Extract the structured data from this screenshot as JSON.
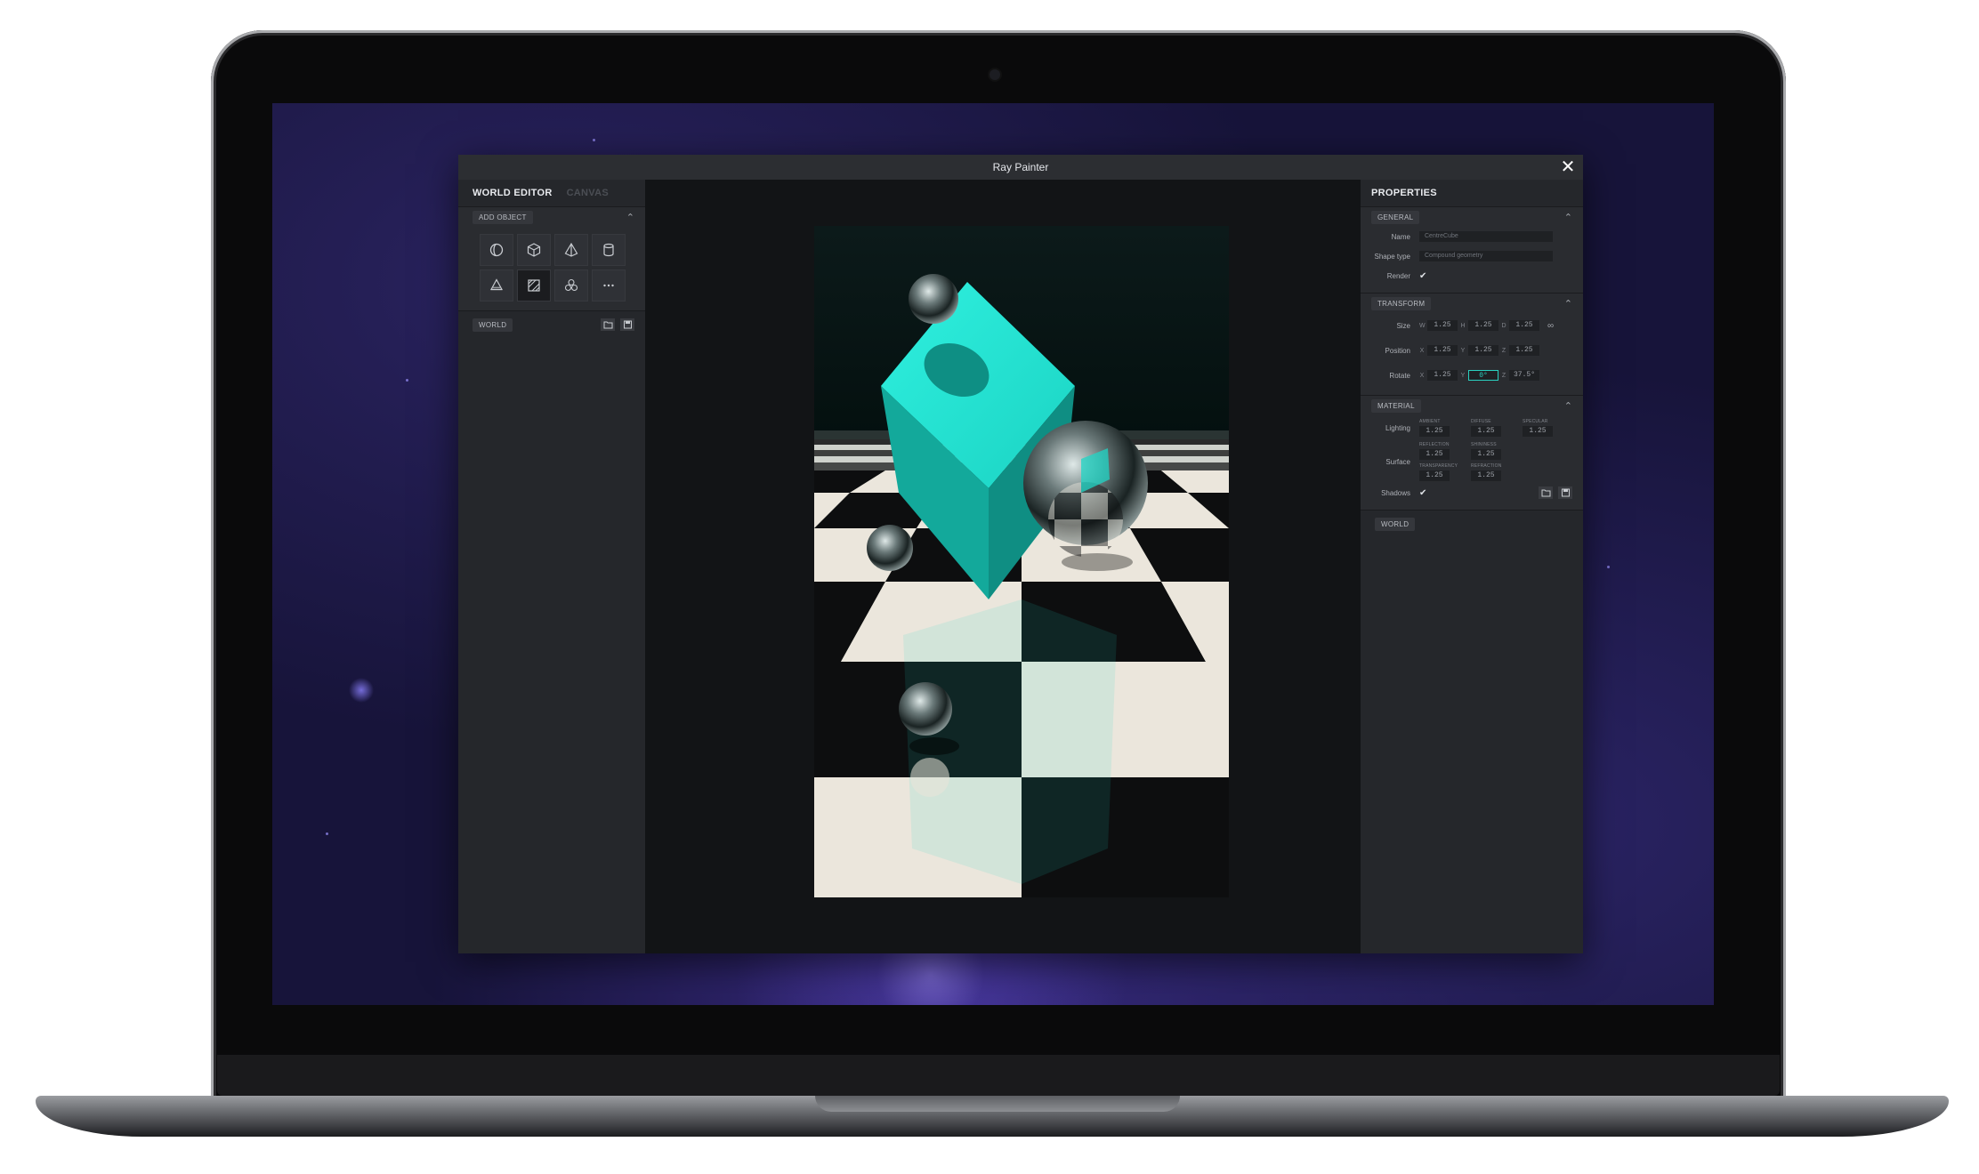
{
  "window": {
    "title": "Ray Painter"
  },
  "left_panel": {
    "tabs": [
      {
        "label": "WORLD EDITOR",
        "active": true
      },
      {
        "label": "CANVAS",
        "active": false
      }
    ],
    "add_object": {
      "label": "ADD OBJECT",
      "tools": [
        "sphere-icon",
        "cube-icon",
        "pyramid-icon",
        "cylinder-icon",
        "cone-icon",
        "plane-icon",
        "compound-icon",
        "more-icon"
      ]
    },
    "world_label": "WORLD"
  },
  "properties": {
    "title": "PROPERTIES",
    "general": {
      "label": "GENERAL",
      "name_label": "Name",
      "name_value": "CentreCube",
      "shape_type_label": "Shape type",
      "shape_type_value": "Compound geometry",
      "render_label": "Render",
      "render_checked": true
    },
    "transform": {
      "label": "TRANSFORM",
      "size": {
        "label": "Size",
        "axes": [
          "W",
          "H",
          "D"
        ],
        "values": [
          "1.25",
          "1.25",
          "1.25"
        ]
      },
      "position": {
        "label": "Position",
        "axes": [
          "X",
          "Y",
          "Z"
        ],
        "values": [
          "1.25",
          "1.25",
          "1.25"
        ]
      },
      "rotate": {
        "label": "Rotate",
        "axes": [
          "X",
          "Y",
          "Z"
        ],
        "values": [
          "1.25",
          "0°",
          "37.5°"
        ]
      }
    },
    "material": {
      "label": "MATERIAL",
      "lighting": {
        "label": "Lighting",
        "fields": [
          {
            "caption": "AMBIENT",
            "value": "1.25"
          },
          {
            "caption": "DIFFUSE",
            "value": "1.25"
          },
          {
            "caption": "SPECULAR",
            "value": "1.25"
          }
        ]
      },
      "surface": {
        "label": "Surface",
        "fields": [
          {
            "caption": "REFLECTION",
            "value": "1.25"
          },
          {
            "caption": "SHININESS",
            "value": "1.25"
          },
          {
            "caption": "TRANSPARENCY",
            "value": "1.25"
          },
          {
            "caption": "REFRACTION",
            "value": "1.25"
          }
        ]
      },
      "shadows_label": "Shadows",
      "shadows_checked": true
    },
    "world_label": "WORLD"
  },
  "colors": {
    "accent": "#2ad1c0",
    "cube": "#1fd6c6"
  }
}
